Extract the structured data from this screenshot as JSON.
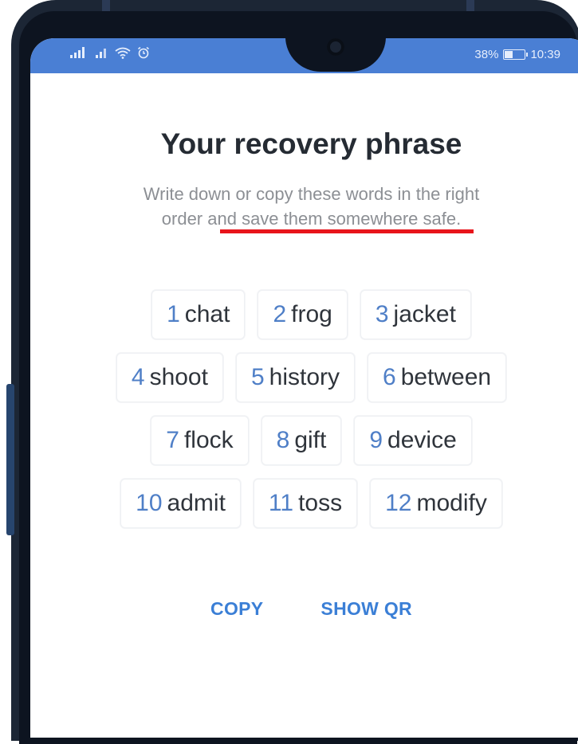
{
  "status_bar": {
    "battery": "38%",
    "time": "10:39",
    "battery_level": 0.38
  },
  "content": {
    "title": "Your recovery phrase",
    "subtitle_line1": "Write down or copy these words in the right",
    "subtitle_line2_prefix": "order and ",
    "subtitle_line2_emphasis": "save them somewhere safe",
    "subtitle_line2_suffix": "."
  },
  "words": [
    {
      "num": "1",
      "word": "chat"
    },
    {
      "num": "2",
      "word": "frog"
    },
    {
      "num": "3",
      "word": "jacket"
    },
    {
      "num": "4",
      "word": "shoot"
    },
    {
      "num": "5",
      "word": "history"
    },
    {
      "num": "6",
      "word": "between"
    },
    {
      "num": "7",
      "word": "flock"
    },
    {
      "num": "8",
      "word": "gift"
    },
    {
      "num": "9",
      "word": "device"
    },
    {
      "num": "10",
      "word": "admit"
    },
    {
      "num": "11",
      "word": "toss"
    },
    {
      "num": "12",
      "word": "modify"
    }
  ],
  "actions": {
    "copy_label": "COPY",
    "show_qr_label": "SHOW QR"
  },
  "colors": {
    "status_bar": "#4a7fd4",
    "accent": "#3b7fd6",
    "highlight_underline": "#e8141b"
  }
}
